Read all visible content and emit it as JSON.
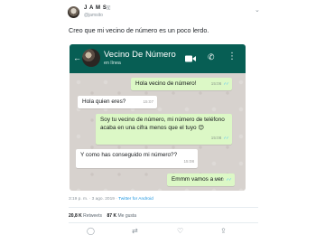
{
  "tweet": {
    "author_name": "J A M S",
    "verified_mark": "🇻",
    "handle": "@jamsito",
    "text": "Creo que mi vecino de número es un poco lerdo.",
    "timestamp": "3:19 p. m. · 3 ago. 2019 ·",
    "source": "Twitter for Android",
    "retweets_count": "20,8 K",
    "retweets_label": "Retweets",
    "likes_count": "87 K",
    "likes_label": "Me gusta"
  },
  "whatsapp": {
    "contact_name": "Vecino De Número",
    "status": "en línea",
    "messages": [
      {
        "direction": "out",
        "text": "Hola vecino de número!",
        "time": "15:06",
        "ticks": "✓✓"
      },
      {
        "direction": "in",
        "text": "Hola quien eres?",
        "time": "15:07"
      },
      {
        "direction": "out",
        "text": "Soy tu vecino de número, mi número de teléfono acaba en una cifra menos que el tuyo 😊",
        "time": "15:08",
        "ticks": "✓✓"
      },
      {
        "direction": "in",
        "text": "Y como has conseguido mi número??",
        "time": "15:08"
      },
      {
        "direction": "out",
        "text": "Emmm vamos a ver",
        "time": "15:12",
        "ticks": "✓✓"
      }
    ]
  },
  "colors": {
    "whatsapp_header": "#075e54",
    "outgoing_bubble": "#dcf8c6",
    "incoming_bubble": "#ffffff",
    "read_ticks": "#4fc3f7",
    "link": "#1b95e0"
  },
  "icons": [
    "back-arrow-icon",
    "video-call-icon",
    "phone-icon",
    "more-options-icon",
    "caret-down-icon",
    "reply-icon",
    "retweet-icon",
    "like-icon",
    "share-icon"
  ]
}
